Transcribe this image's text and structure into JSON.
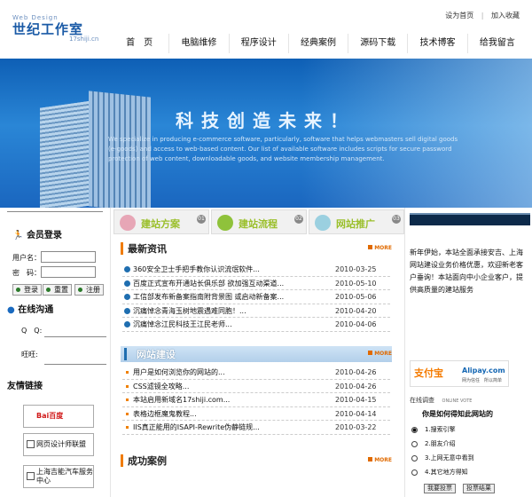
{
  "header": {
    "logo_small": "Web Design",
    "logo_main": "世纪工作室",
    "logo_domain": "17shiji.cn",
    "top_links": [
      "设为首页",
      "加入收藏"
    ]
  },
  "nav": {
    "items": [
      "首　页",
      "电脑维修",
      "程序设计",
      "经典案例",
      "源码下载",
      "技术博客",
      "给我留言"
    ]
  },
  "banner": {
    "slogan": "科技创造未来！",
    "description": "We specialize in producing e-commerce software, particularly, software that helps webmasters sell digital goods (e-goods) and access to web-based content. Our list of available software includes scripts for secure password protection of web content, downloadable goods, and website membership management."
  },
  "member": {
    "title": "会员登录",
    "username_label": "用户名：",
    "password_label": "密　码：",
    "buttons": [
      "登录",
      "重置",
      "注册"
    ]
  },
  "online": {
    "title": "在线沟通",
    "qq_label": "Q　Q:",
    "wangwang_label": "旺旺:"
  },
  "friends": {
    "title": "友情链接",
    "links": [
      "Bai百度",
      "网页设计师联盟",
      "上海吉能汽车服务中心"
    ]
  },
  "tabs": [
    {
      "label": "建站方案",
      "num": "01",
      "color": "#e7a6b6"
    },
    {
      "label": "建站流程",
      "num": "02",
      "color": "#8fc23b"
    },
    {
      "label": "网站推广",
      "num": "03",
      "color": "#9bd0e0"
    }
  ],
  "latest_news": {
    "title": "最新资讯",
    "more": "MORE",
    "items": [
      {
        "title": "360安全卫士手把手教你认识流氓软件...",
        "date": "2010-03-25"
      },
      {
        "title": "百度正式宣布开通站长俱乐部 欲加强互动渠道...",
        "date": "2010-05-10"
      },
      {
        "title": "工信部发布新备案指南附背景图 或启动新备案...",
        "date": "2010-05-06"
      },
      {
        "title": "沉痛悼念青海玉树地震遇难同胞！...",
        "date": "2010-04-20"
      },
      {
        "title": "沉痛悼念江民科技王江民老师...",
        "date": "2010-04-06"
      }
    ]
  },
  "web_building": {
    "title": "网站建设",
    "more": "MORE",
    "items": [
      {
        "title": "用户是如何浏览你的网站的...",
        "date": "2010-04-26"
      },
      {
        "title": "CSS滤镜全攻略...",
        "date": "2010-04-26"
      },
      {
        "title": "本站启用新域名17shiji.com...",
        "date": "2010-04-15"
      },
      {
        "title": "表格边框魔鬼教程...",
        "date": "2010-04-14"
      },
      {
        "title": "IIS真正能用的ISAPI-Rewrite伪静链规...",
        "date": "2010-03-22"
      }
    ]
  },
  "cases": {
    "title": "成功案例",
    "more": "MORE"
  },
  "notice": {
    "text": "新年伊始，本站全面承接安吉、上海网站建设业务价格优惠，欢迎新老客户垂询！本站面向中小企业客户，提供高质量的建站服务"
  },
  "alipay": {
    "cn": "支付宝",
    "en": "Alipay.com",
    "sub": "网为信任　所以简单"
  },
  "vote": {
    "title": "在线调查",
    "title_en": "ONLINE VOTE",
    "question": "你是如何得知此网站的",
    "options": [
      "1.搜索引擎",
      "2.朋友介绍",
      "3.上网无意中看到",
      "4.其它地方得知"
    ],
    "buttons": [
      "我要投票",
      "投票结果"
    ]
  }
}
